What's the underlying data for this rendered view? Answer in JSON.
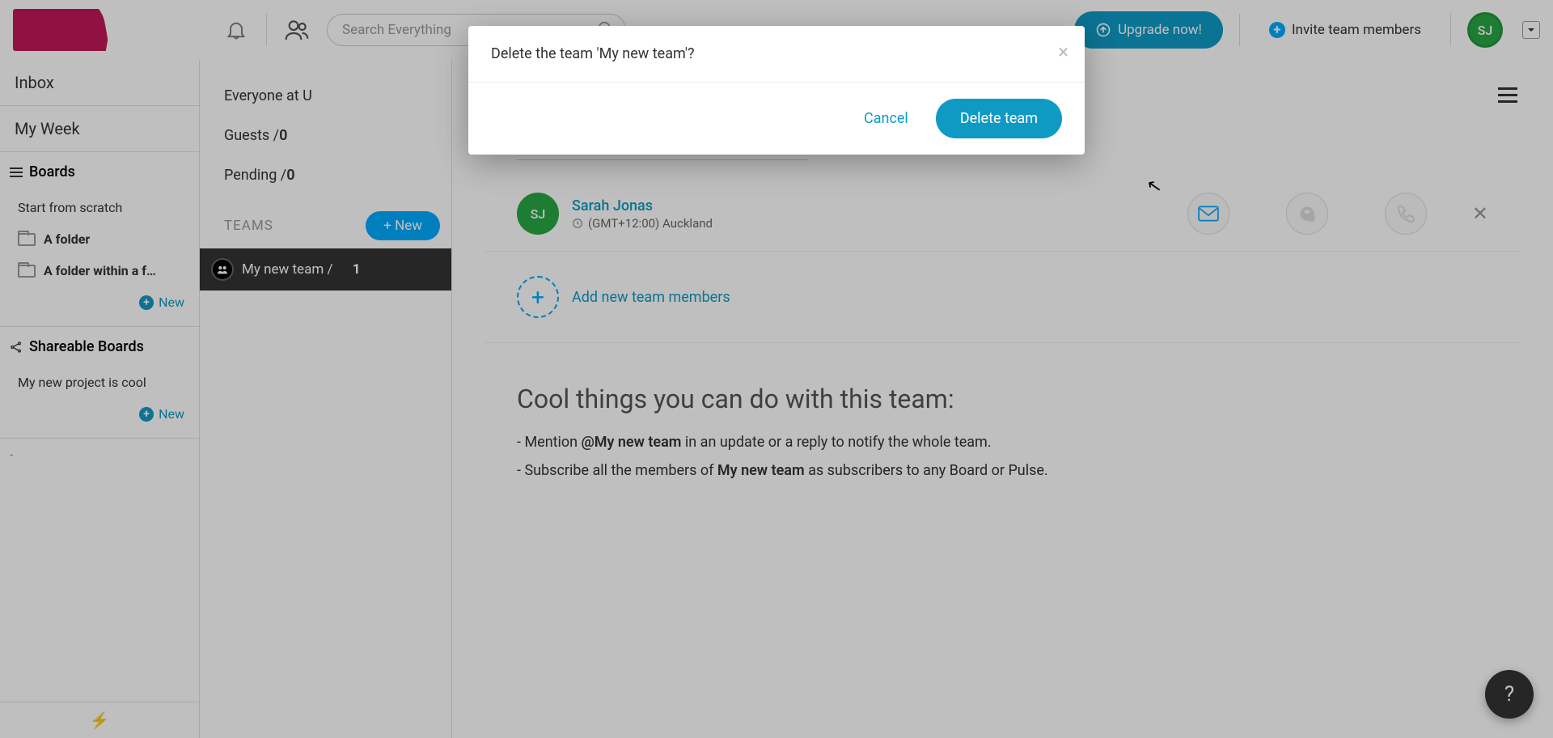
{
  "topbar": {
    "search_placeholder": "Search Everything",
    "upgrade_label": "Upgrade now!",
    "invite_label": "Invite team members",
    "avatar_initials": "SJ"
  },
  "sidebar": {
    "inbox": "Inbox",
    "myweek": "My Week",
    "boards_header": "Boards",
    "board_items": [
      "Start from scratch",
      "A folder",
      "A folder within a f…"
    ],
    "new_label": "New",
    "shareable_header": "Shareable Boards",
    "shareable_items": [
      "My new project is cool"
    ],
    "dash": "-"
  },
  "midpanel": {
    "everyone_prefix": "Everyone at U",
    "guests_label": "Guests /",
    "guests_count": "0",
    "pending_label": "Pending /",
    "pending_count": "0",
    "teams_label": "TEAMS",
    "new_btn": "+ New",
    "team_name": "My new team /",
    "team_count": "1"
  },
  "main": {
    "add_member_placeholder": "Add new team member",
    "member": {
      "initials": "SJ",
      "name": "Sarah Jonas",
      "timezone": "(GMT+12:00) Auckland"
    },
    "add_members_label": "Add new team members",
    "cool_title": "Cool things you can do with this team:",
    "line1_a": "- Mention ",
    "line1_b": "@My new team",
    "line1_c": " in an update or a reply to notify the whole team.",
    "line2_a": "- Subscribe all the members of ",
    "line2_b": "My new team",
    "line2_c": " as subscribers to any Board or Pulse."
  },
  "modal": {
    "message": "Delete the team 'My new team'?",
    "cancel": "Cancel",
    "delete": "Delete team"
  },
  "help": "?"
}
